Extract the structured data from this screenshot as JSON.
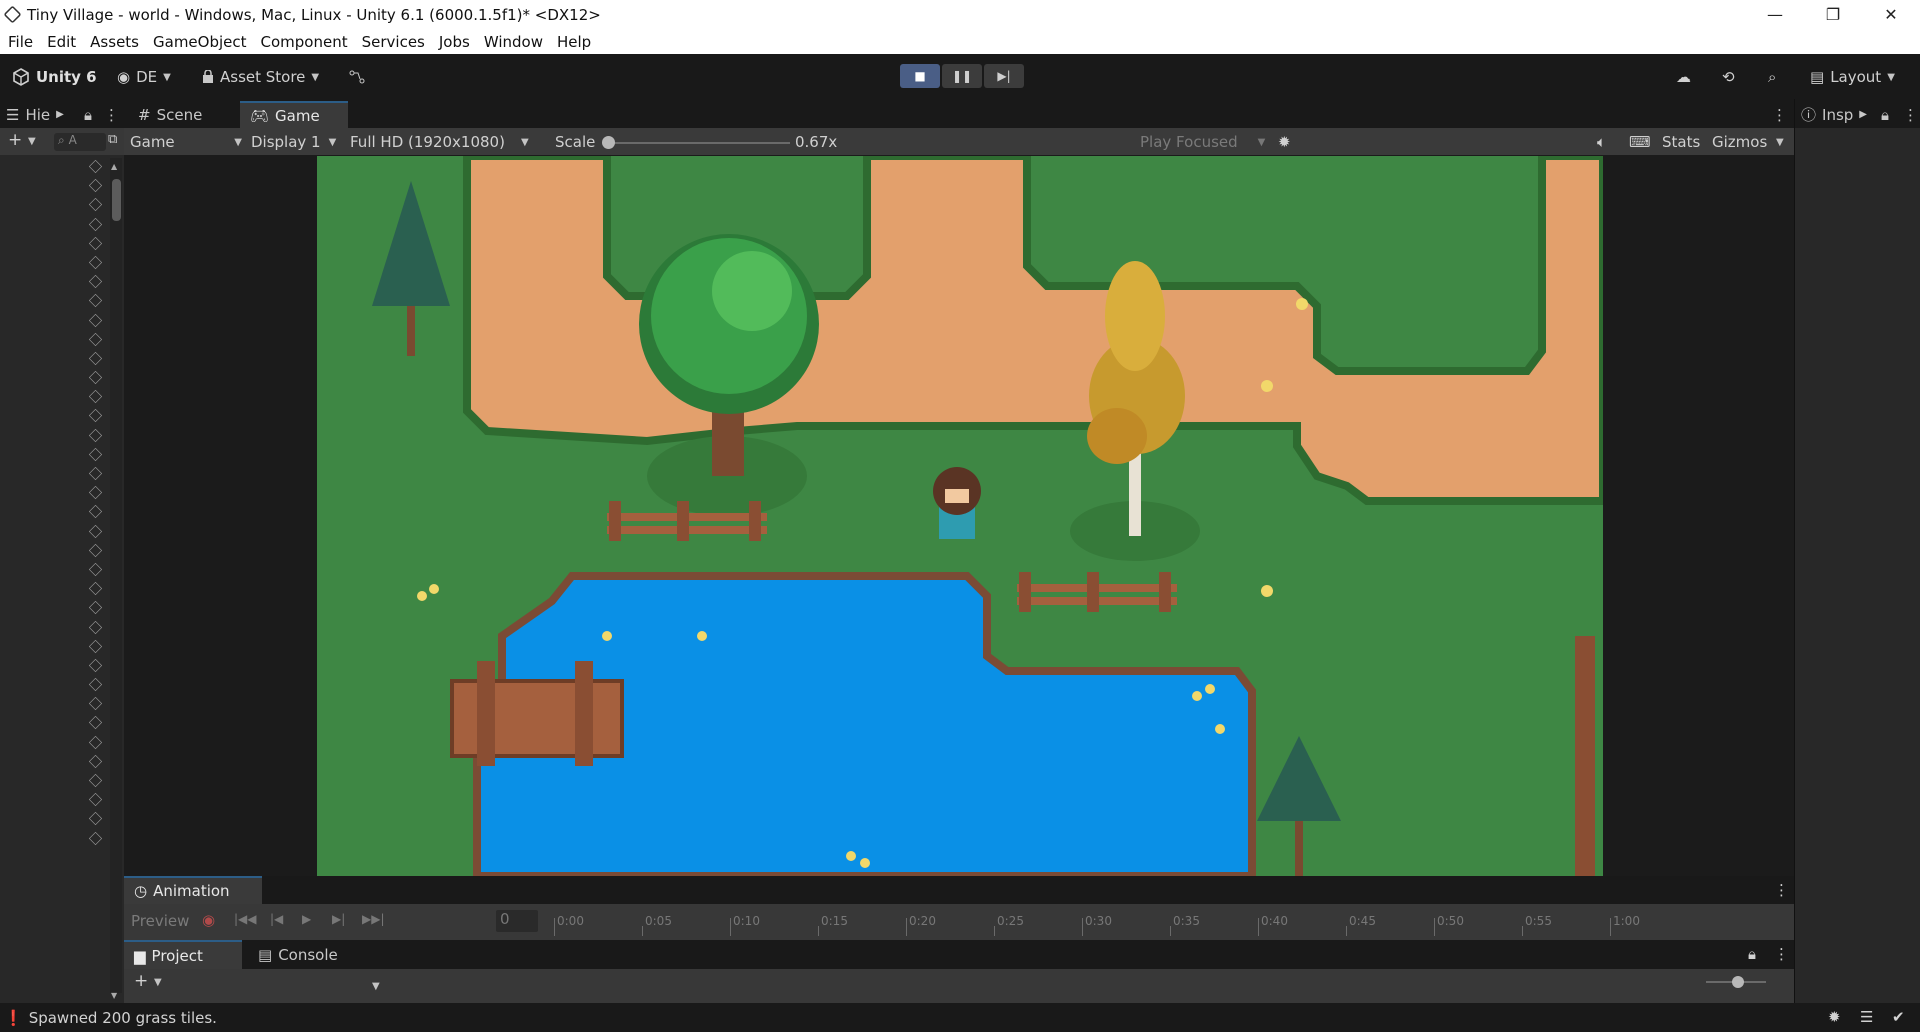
{
  "window": {
    "title": "Tiny Village - world - Windows, Mac, Linux - Unity 6.1 (6000.1.5f1)* <DX12>",
    "minimize": "—",
    "maximize": "❐",
    "close": "✕"
  },
  "menu": [
    "File",
    "Edit",
    "Assets",
    "GameObject",
    "Component",
    "Services",
    "Jobs",
    "Window",
    "Help"
  ],
  "toolbar": {
    "unity_label": "Unity 6",
    "account": "DE",
    "asset_store": "Asset Store",
    "layout": "Layout"
  },
  "tabs": {
    "hierarchy": "Hie",
    "scene": "Scene",
    "game": "Game",
    "inspector": "Insp"
  },
  "game_toolbar": {
    "view_mode": "Game",
    "display": "Display 1",
    "resolution": "Full HD (1920x1080)",
    "scale_label": "Scale",
    "scale_value": "0.67x",
    "scale_fraction": 0.0,
    "play_focused": "Play Focused",
    "stats": "Stats",
    "gizmos": "Gizmos"
  },
  "hierarchy": {
    "search_placeholder": "A",
    "object_count": 36
  },
  "animation": {
    "tab": "Animation",
    "preview": "Preview",
    "frame": "0",
    "ticks": [
      "0:00",
      "0:05",
      "0:10",
      "0:15",
      "0:20",
      "0:25",
      "0:30",
      "0:35",
      "0:40",
      "0:45",
      "0:50",
      "0:55",
      "1:00"
    ]
  },
  "project": {
    "tab_project": "Project",
    "tab_console": "Console"
  },
  "status": {
    "message": "Spawned 200 grass tiles."
  },
  "colors": {
    "grass": "#3e8744",
    "path": "#e3a06c",
    "water": "#0f8fe6",
    "play_active": "#4a5e86"
  }
}
